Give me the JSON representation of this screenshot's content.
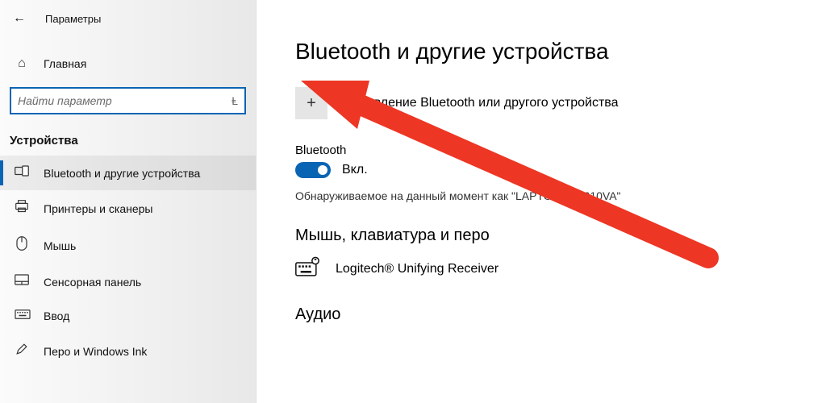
{
  "header": {
    "app_title": "Параметры"
  },
  "sidebar": {
    "home_label": "Главная",
    "search_placeholder": "Найти параметр",
    "category_label": "Устройства",
    "items": [
      {
        "label": "Bluetooth и другие устройства"
      },
      {
        "label": "Принтеры и сканеры"
      },
      {
        "label": "Мышь"
      },
      {
        "label": "Сенсорная панель"
      },
      {
        "label": "Ввод"
      },
      {
        "label": "Перо и Windows Ink"
      }
    ]
  },
  "main": {
    "page_title": "Bluetooth и другие устройства",
    "add_device_label": "Добавление Bluetooth или другого устройства",
    "bluetooth_label": "Bluetooth",
    "toggle_state": "Вкл.",
    "discoverable_text": "Обнаруживаемое на данный момент как \"LAPTOP-65P610VA\"",
    "mouse_section": "Мышь, клавиатура и перо",
    "device_name": "Logitech® Unifying Receiver",
    "audio_section": "Аудио"
  }
}
